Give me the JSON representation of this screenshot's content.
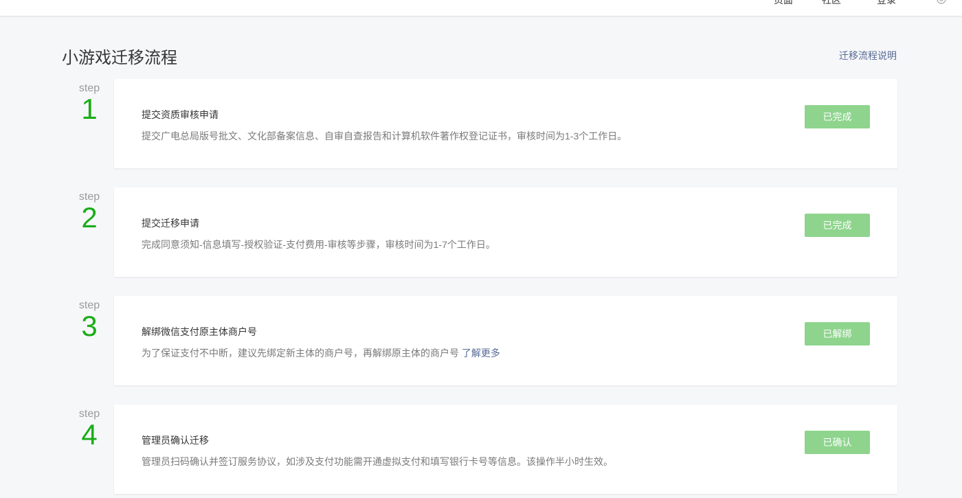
{
  "topbar": {
    "items": [
      "页面",
      "社区",
      "登录"
    ]
  },
  "page": {
    "title": "小游戏迁移流程",
    "help_link": "迁移流程说明"
  },
  "steps": [
    {
      "label": "step",
      "number": "1",
      "title": "提交资质审核申请",
      "desc": "提交广电总局版号批文、文化部备案信息、自审自查报告和计算机软件著作权登记证书，审核时间为1-3个工作日。",
      "link": "",
      "status": "已完成"
    },
    {
      "label": "step",
      "number": "2",
      "title": "提交迁移申请",
      "desc": "完成同意须知-信息填写-授权验证-支付费用-审核等步骤，审核时间为1-7个工作日。",
      "link": "",
      "status": "已完成"
    },
    {
      "label": "step",
      "number": "3",
      "title": "解绑微信支付原主体商户号",
      "desc": "为了保证支付不中断，建议先绑定新主体的商户号，再解绑原主体的商户号",
      "link": "了解更多",
      "status": "已解绑"
    },
    {
      "label": "step",
      "number": "4",
      "title": "管理员确认迁移",
      "desc": "管理员扫码确认并签订服务协议，如涉及支付功能需开通虚拟支付和填写银行卡号等信息。该操作半小时生效。",
      "link": "",
      "status": "已确认"
    }
  ],
  "colors": {
    "accent_green": "#1aad19",
    "button_disabled": "#8ed48d",
    "link": "#576b95",
    "background": "#f6f7f9"
  }
}
